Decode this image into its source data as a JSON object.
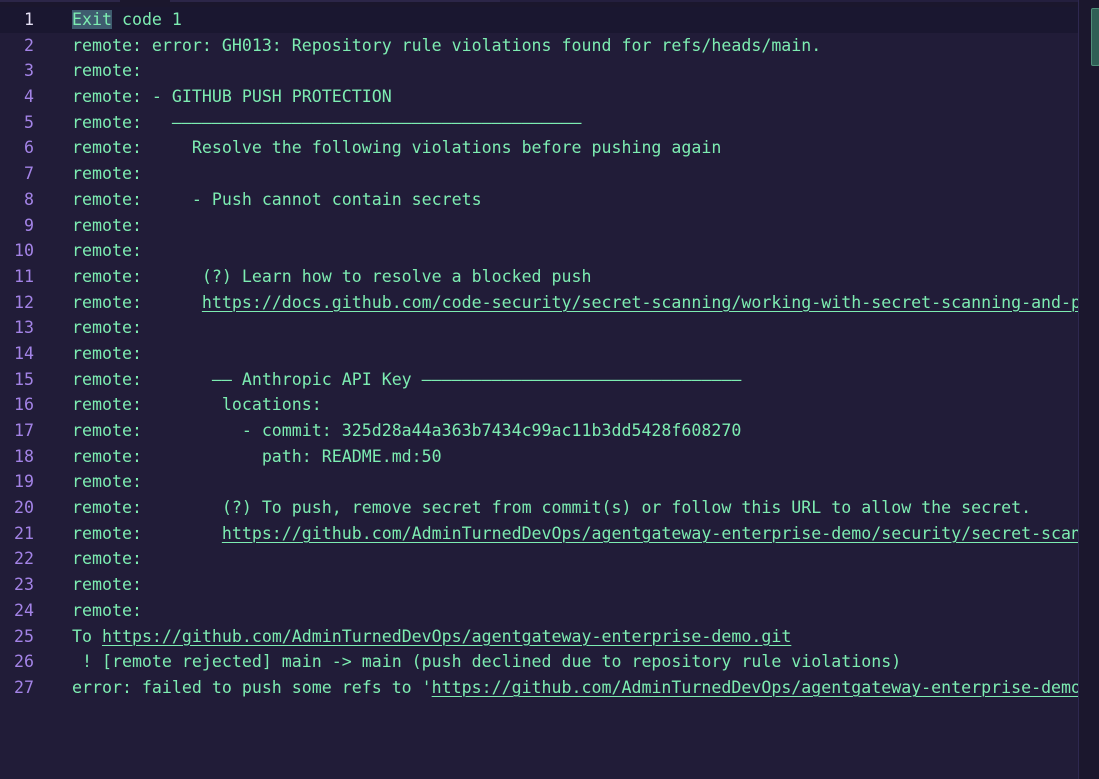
{
  "active_line": 1,
  "line_numbers": [
    "1",
    "2",
    "3",
    "4",
    "5",
    "6",
    "7",
    "8",
    "9",
    "10",
    "11",
    "12",
    "13",
    "14",
    "15",
    "16",
    "17",
    "18",
    "19",
    "20",
    "21",
    "22",
    "23",
    "24",
    "25",
    "26",
    "27"
  ],
  "lines": [
    {
      "sel": "Exit",
      "text": " code 1"
    },
    {
      "text": "remote: error: GH013: Repository rule violations found for refs/heads/main."
    },
    {
      "text": "remote:"
    },
    {
      "text": "remote: - GITHUB PUSH PROTECTION"
    },
    {
      "text": "remote:   —————————————————————————————————————————"
    },
    {
      "text": "remote:     Resolve the following violations before pushing again"
    },
    {
      "text": "remote:"
    },
    {
      "text": "remote:     - Push cannot contain secrets"
    },
    {
      "text": "remote:"
    },
    {
      "text": "remote:"
    },
    {
      "text": "remote:      (?) Learn how to resolve a blocked push"
    },
    {
      "prefix": "remote:      ",
      "link": "https://docs.github.com/code-security/secret-scanning/working-with-secret-scanning-and-push-protection/working-with-push-protection-from-the-command-line#resolving-a-blocked-push"
    },
    {
      "text": "remote:"
    },
    {
      "text": "remote:"
    },
    {
      "text": "remote:       —— Anthropic API Key ————————————————————————————————"
    },
    {
      "text": "remote:        locations:"
    },
    {
      "text": "remote:          - commit: 325d28a44a363b7434c99ac11b3dd5428f608270"
    },
    {
      "text": "remote:            path: README.md:50"
    },
    {
      "text": "remote:"
    },
    {
      "text": "remote:        (?) To push, remove secret from commit(s) or follow this URL to allow the secret."
    },
    {
      "prefix": "remote:        ",
      "link": "https://github.com/AdminTurnedDevOps/agentgateway-enterprise-demo/security/secret-scanning/unblock-secret"
    },
    {
      "text": "remote:"
    },
    {
      "text": "remote:"
    },
    {
      "text": "remote:"
    },
    {
      "prefix": "To ",
      "link": "https://github.com/AdminTurnedDevOps/agentgateway-enterprise-demo.git"
    },
    {
      "text": " ! [remote rejected] main -> main (push declined due to repository rule violations)"
    },
    {
      "prefix": "error: failed to push some refs to '",
      "link": "https://github.com/AdminTurnedDevOps/agentgateway-enterprise-demo.git'"
    }
  ],
  "colors": {
    "background": "#211c38",
    "text": "#7dedb2",
    "line_number": "#a383e6",
    "active_line_number": "#e6e1f5",
    "selection": "#3f5c6f"
  }
}
